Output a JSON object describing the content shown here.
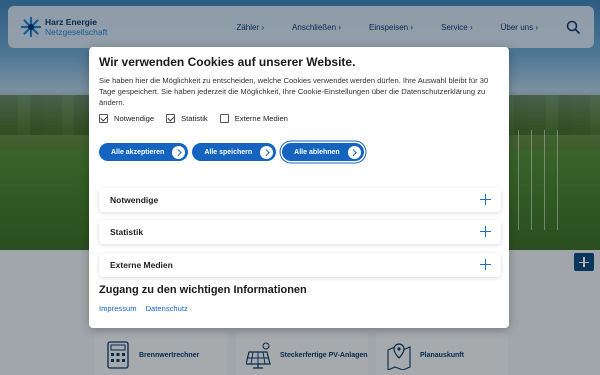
{
  "header": {
    "logo_line1": "Harz Energie",
    "logo_line2": "Netzgesellschaft",
    "nav": [
      "Zähler",
      "Anschließen",
      "Einspeisen",
      "Service",
      "Über uns"
    ],
    "nav_chevron": "›"
  },
  "consent": {
    "title": "Wir verwenden Cookies auf unserer Website.",
    "description": "Sie haben hier die Möglichkeit zu entscheiden, welche Cookies verwendet werden dürfen. Ihre Auswahl bleibt für 30 Tage gespeichert. Sie haben jederzeit die Möglichkeit, Ihre Cookie-Einstellungen über die Datenschutzerklärung zu ändern.",
    "checkboxes": [
      {
        "label": "Notwendige",
        "checked": true
      },
      {
        "label": "Statistik",
        "checked": true
      },
      {
        "label": "Externe Medien",
        "checked": false
      }
    ],
    "buttons": {
      "accept_all": "Alle akzeptieren",
      "save_all": "Alle speichern",
      "reject_all": "Alle ablehnen"
    },
    "accordion": [
      "Notwendige",
      "Statistik",
      "Externe Medien"
    ],
    "info_title": "Zugang zu den wichtigen Informationen",
    "links": [
      "Impressum",
      "Datenschutz"
    ]
  },
  "tiles": [
    {
      "label": "Brennwertrechner",
      "icon": "calculator-icon"
    },
    {
      "label": "Steckerfertige PV-Anlagen",
      "icon": "solar-panel-icon"
    },
    {
      "label": "Planauskunft",
      "icon": "map-pin-icon"
    }
  ],
  "colors": {
    "primary": "#1565c0",
    "dark_blue": "#0b3a6e",
    "light_blue": "#1e7fd0"
  }
}
